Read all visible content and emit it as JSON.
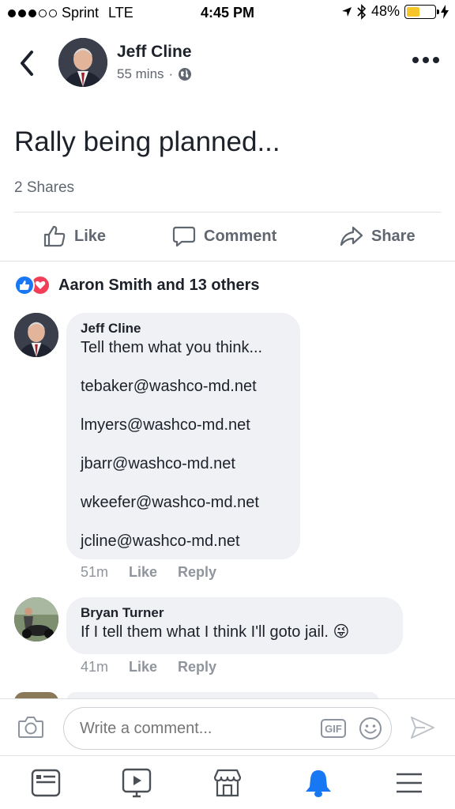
{
  "status_bar": {
    "carrier": "Sprint",
    "network": "LTE",
    "time": "4:45 PM",
    "battery": "48%",
    "battery_level": 0.48
  },
  "post": {
    "author": "Jeff Cline",
    "time_ago": "55 mins",
    "separator": "·",
    "text": "Rally being planned...",
    "shares": "2 Shares"
  },
  "actions": {
    "like": "Like",
    "comment": "Comment",
    "share": "Share"
  },
  "reactions": {
    "summary": "Aaron Smith and 13 others"
  },
  "comments": [
    {
      "author": "Jeff Cline",
      "lines": [
        "Tell them what you think...",
        "tebaker@washco-md.net",
        "lmyers@washco-md.net",
        "jbarr@washco-md.net",
        "wkeefer@washco-md.net",
        "jcline@washco-md.net"
      ],
      "time": "51m",
      "like": "Like",
      "reply": "Reply"
    },
    {
      "author": "Bryan Turner",
      "text": "If I tell them what I think I'll goto jail.",
      "emoji": "😜",
      "time": "41m",
      "like": "Like",
      "reply": "Reply"
    }
  ],
  "composer": {
    "placeholder": "Write a comment...",
    "gif": "GIF"
  },
  "colors": {
    "accent": "#1877f2",
    "love": "#f33e58",
    "bubble": "#f0f1f4",
    "muted": "#606770"
  }
}
